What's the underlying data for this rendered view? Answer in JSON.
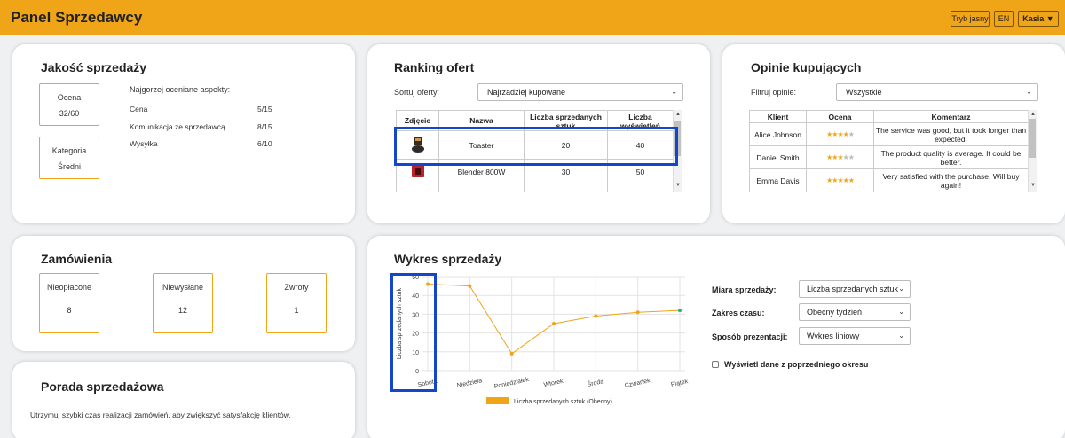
{
  "header": {
    "title": "Panel Sprzedawcy",
    "theme_button": "Tryb jasny",
    "lang_button": "EN",
    "user_button": "Kasia ▼"
  },
  "quality": {
    "title": "Jakość sprzedaży",
    "score_label": "Ocena",
    "score_value": "32/60",
    "category_label": "Kategoria",
    "category_value": "Średni",
    "worst_title": "Najgorzej oceniane aspekty:",
    "aspects": [
      {
        "name": "Cena",
        "value": "5/15"
      },
      {
        "name": "Komunikacja ze sprzedawcą",
        "value": "8/15"
      },
      {
        "name": "Wysyłka",
        "value": "6/10"
      }
    ]
  },
  "ranking": {
    "title": "Ranking ofert",
    "sort_label": "Sortuj oferty:",
    "sort_value": "Najrzadziej kupowane",
    "columns": [
      "Zdjęcie",
      "Nazwa",
      "Liczba sprzedanych sztuk",
      "Liczba wyświetleń"
    ],
    "rows": [
      {
        "name": "Toaster",
        "sold": "20",
        "views": "40",
        "icon": "toaster-icon"
      },
      {
        "name": "Blender 800W",
        "sold": "30",
        "views": "50",
        "icon": "blender-icon"
      }
    ]
  },
  "opinions": {
    "title": "Opinie kupujących",
    "filter_label": "Filtruj opinie:",
    "filter_value": "Wszystkie",
    "columns": [
      "Klient",
      "Ocena",
      "Komentarz"
    ],
    "rows": [
      {
        "client": "Alice Johnson",
        "rating": 4,
        "comment": "The service was good, but it took longer than expected."
      },
      {
        "client": "Daniel Smith",
        "rating": 3,
        "comment": "The product quality is average. It could be better."
      },
      {
        "client": "Emma Davis",
        "rating": 5,
        "comment": "Very satisfied with the purchase. Will buy again!"
      }
    ]
  },
  "orders": {
    "title": "Zamówienia",
    "unpaid_label": "Nieopłacone",
    "unpaid_value": "8",
    "unsent_label": "Niewysłane",
    "unsent_value": "12",
    "returns_label": "Zwroty",
    "returns_value": "1"
  },
  "tip": {
    "title": "Porada sprzedażowa",
    "text": "Utrzymuj szybki czas realizacji zamówień, aby zwiększyć satysfakcję klientów."
  },
  "sales": {
    "title": "Wykres sprzedaży",
    "measure_label": "Miara sprzedaży:",
    "measure_value": "Liczba sprzedanych sztuk",
    "range_label": "Zakres czasu:",
    "range_value": "Obecny tydzień",
    "mode_label": "Sposób prezentacji:",
    "mode_value": "Wykres liniowy",
    "prev_period_label": "Wyświetl dane z poprzedniego okresu"
  },
  "chart_data": {
    "type": "line",
    "categories": [
      "Sobota",
      "Niedziela",
      "Poniedziałek",
      "Wtorek",
      "Środa",
      "Czwartek",
      "Piątek"
    ],
    "series": [
      {
        "name": "Liczba sprzedanych sztuk (Obecny)",
        "values": [
          46,
          45,
          9,
          25,
          29,
          31,
          32
        ],
        "color": "#f0a418"
      }
    ],
    "ylabel": "Liczba sprzedanych sztuk",
    "xlabel": "",
    "ylim": [
      0,
      50
    ],
    "yticks": [
      "0",
      "10",
      "20",
      "30",
      "40",
      "50"
    ],
    "grid": true,
    "legend": "bottom",
    "accent": "#f0a418",
    "highlight_color": "#1447c8"
  }
}
